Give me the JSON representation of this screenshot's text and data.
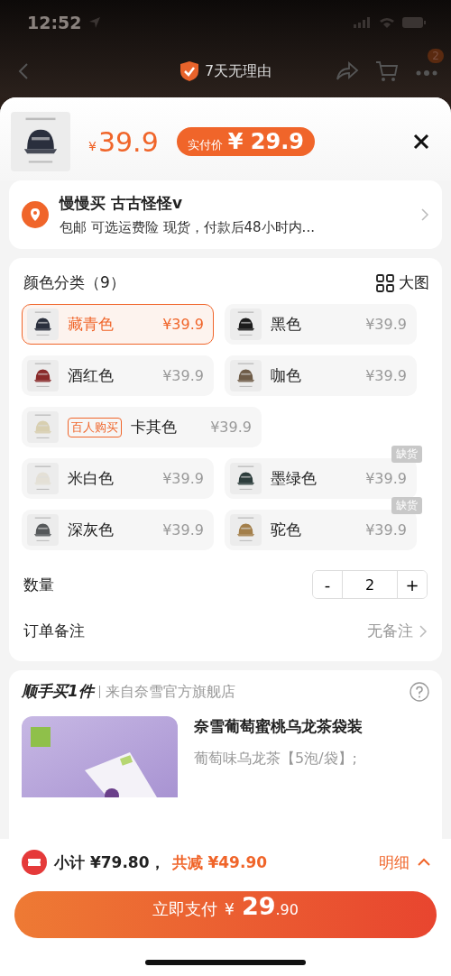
{
  "status_bar": {
    "time": "12:52"
  },
  "nav": {
    "title": "7天无理由",
    "badge": "2"
  },
  "product": {
    "price_symbol": "¥",
    "price": "39.9",
    "pill_label": "实付价",
    "pill_price": "¥ 29.9"
  },
  "address": {
    "name": "慢慢买  古古怪怪v",
    "detail": "包邮  可选运费险  现货，付款后48小时内..."
  },
  "colors": {
    "title": "颜色分类（9）",
    "view_toggle": "大图",
    "rows": [
      {
        "options": [
          {
            "name": "藏青色",
            "price": "¥39.9",
            "selected": true
          },
          {
            "name": "黑色",
            "price": "¥39.9",
            "selected": false
          }
        ]
      },
      {
        "options": [
          {
            "name": "酒红色",
            "price": "¥39.9",
            "selected": false
          },
          {
            "name": "咖色",
            "price": "¥39.9",
            "selected": false
          }
        ]
      },
      {
        "options": [
          {
            "name": "卡其色",
            "price": "¥39.9",
            "selected": false,
            "badge": "百人购买"
          }
        ]
      },
      {
        "options": [
          {
            "name": "米白色",
            "price": "¥39.9",
            "selected": false
          },
          {
            "name": "墨绿色",
            "price": "¥39.9",
            "selected": false,
            "tag": "缺货"
          }
        ]
      },
      {
        "options": [
          {
            "name": "深灰色",
            "price": "¥39.9",
            "selected": false
          },
          {
            "name": "驼色",
            "price": "¥39.9",
            "selected": false,
            "tag": "缺货"
          }
        ]
      }
    ]
  },
  "quantity": {
    "label": "数量",
    "minus": "-",
    "value": "2",
    "plus": "+"
  },
  "remark": {
    "label": "订单备注",
    "value": "无备注"
  },
  "addon": {
    "title": "顺手买1件",
    "source": "来自奈雪官方旗舰店",
    "product_title": "奈雪葡萄蜜桃乌龙茶袋装",
    "product_spec": "葡萄味乌龙茶【5泡/袋】;"
  },
  "summary": {
    "subtotal": "小计 ¥79.80，",
    "discount": "共减 ¥49.90",
    "details": "明细"
  },
  "pay_button": {
    "label": "立即支付",
    "currency": "¥",
    "amount": "29",
    "cents": ".90"
  }
}
